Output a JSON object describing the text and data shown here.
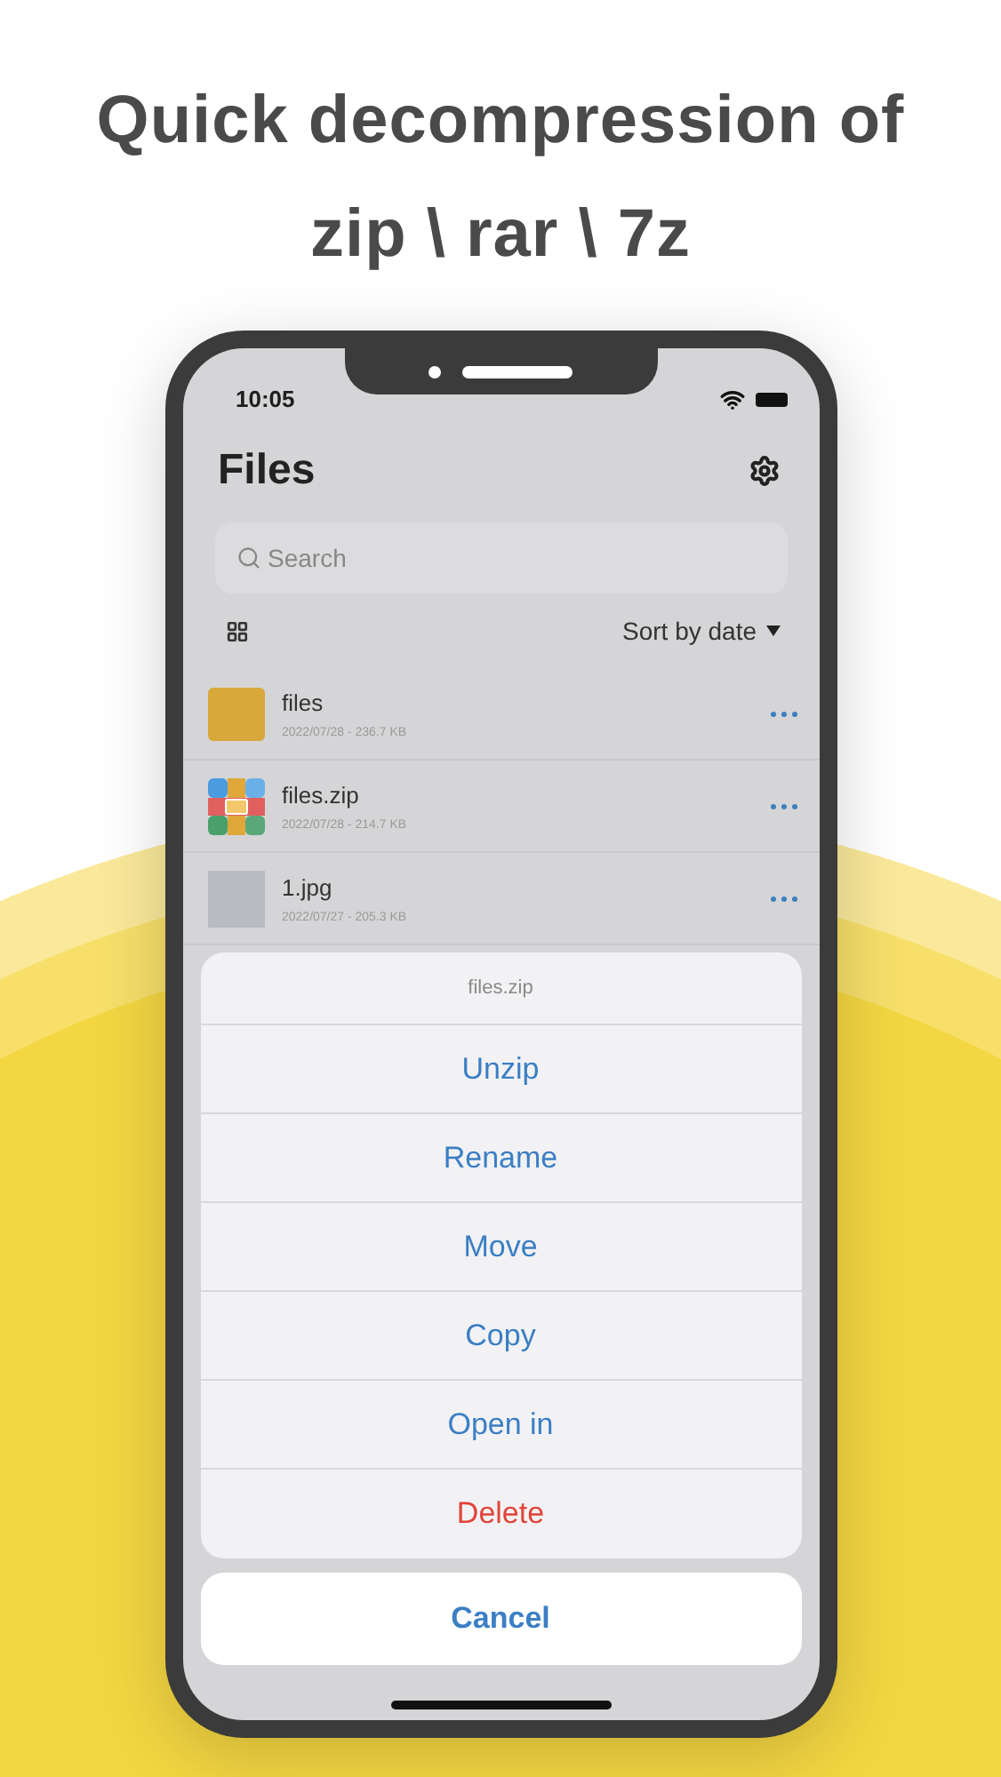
{
  "headline": [
    "Quick decompression of",
    "zip \\ rar \\ 7z"
  ],
  "status_bar": {
    "time": "10:05"
  },
  "header": {
    "title": "Files"
  },
  "search": {
    "placeholder": "Search"
  },
  "sort": {
    "label": "Sort by date"
  },
  "files": [
    {
      "kind": "folder",
      "name": "files",
      "meta": "2022/07/28 - 236.7 KB"
    },
    {
      "kind": "archive",
      "name": "files.zip",
      "meta": "2022/07/28 - 214.7 KB"
    },
    {
      "kind": "image",
      "name": "1.jpg",
      "meta": "2022/07/27 - 205.3 KB"
    }
  ],
  "action_sheet": {
    "title": "files.zip",
    "actions": [
      {
        "label": "Unzip",
        "kind": "normal"
      },
      {
        "label": "Rename",
        "kind": "normal"
      },
      {
        "label": "Move",
        "kind": "normal"
      },
      {
        "label": "Copy",
        "kind": "normal"
      },
      {
        "label": "Open in",
        "kind": "normal"
      },
      {
        "label": "Delete",
        "kind": "destructive"
      }
    ],
    "cancel": "Cancel"
  }
}
